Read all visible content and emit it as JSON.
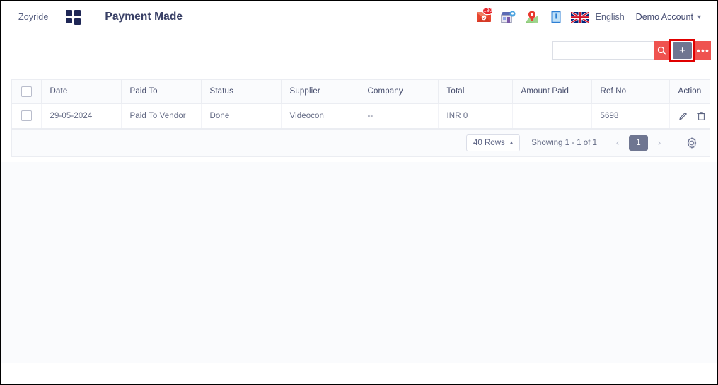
{
  "topbar": {
    "brand": "Zoyride",
    "logo_icon": "grid-squares-icon",
    "page_title": "Payment Made",
    "icons": [
      {
        "name": "mail-envelope-icon",
        "badge": "180"
      },
      {
        "name": "store-location-icon",
        "badge": ""
      },
      {
        "name": "map-pin-icon",
        "badge": ""
      },
      {
        "name": "info-book-icon",
        "badge": ""
      },
      {
        "name": "uk-flag-icon",
        "badge": ""
      }
    ],
    "language": "English",
    "account": "Demo Account",
    "account_caret": "⌄"
  },
  "toolbar": {
    "search_value": "",
    "search_placeholder": "",
    "search_icon": "search-icon",
    "add_label": "+",
    "more_label": "•••",
    "highlight_color": "#e00000",
    "accent_red": "#ef5350",
    "accent_gray": "#6f7691"
  },
  "table": {
    "columns": [
      "Date",
      "Paid To",
      "Status",
      "Supplier",
      "Company",
      "Total",
      "Amount Paid",
      "Ref No",
      "Action"
    ],
    "rows": [
      {
        "date": "29-05-2024",
        "paid_to": "Paid To Vendor",
        "status": "Done",
        "supplier": "Videocon",
        "company": "--",
        "total": "INR 0",
        "amount_paid": "",
        "ref_no": "5698",
        "actions": [
          "edit-pencil-icon",
          "delete-trash-icon"
        ]
      }
    ]
  },
  "pagination": {
    "rows_per_page": "40 Rows",
    "rows_caret": "⌃",
    "showing": "Showing  1 - 1 of 1",
    "prev": "‹",
    "next": "›",
    "current_page": "1",
    "settings_icon": "gear-icon"
  }
}
